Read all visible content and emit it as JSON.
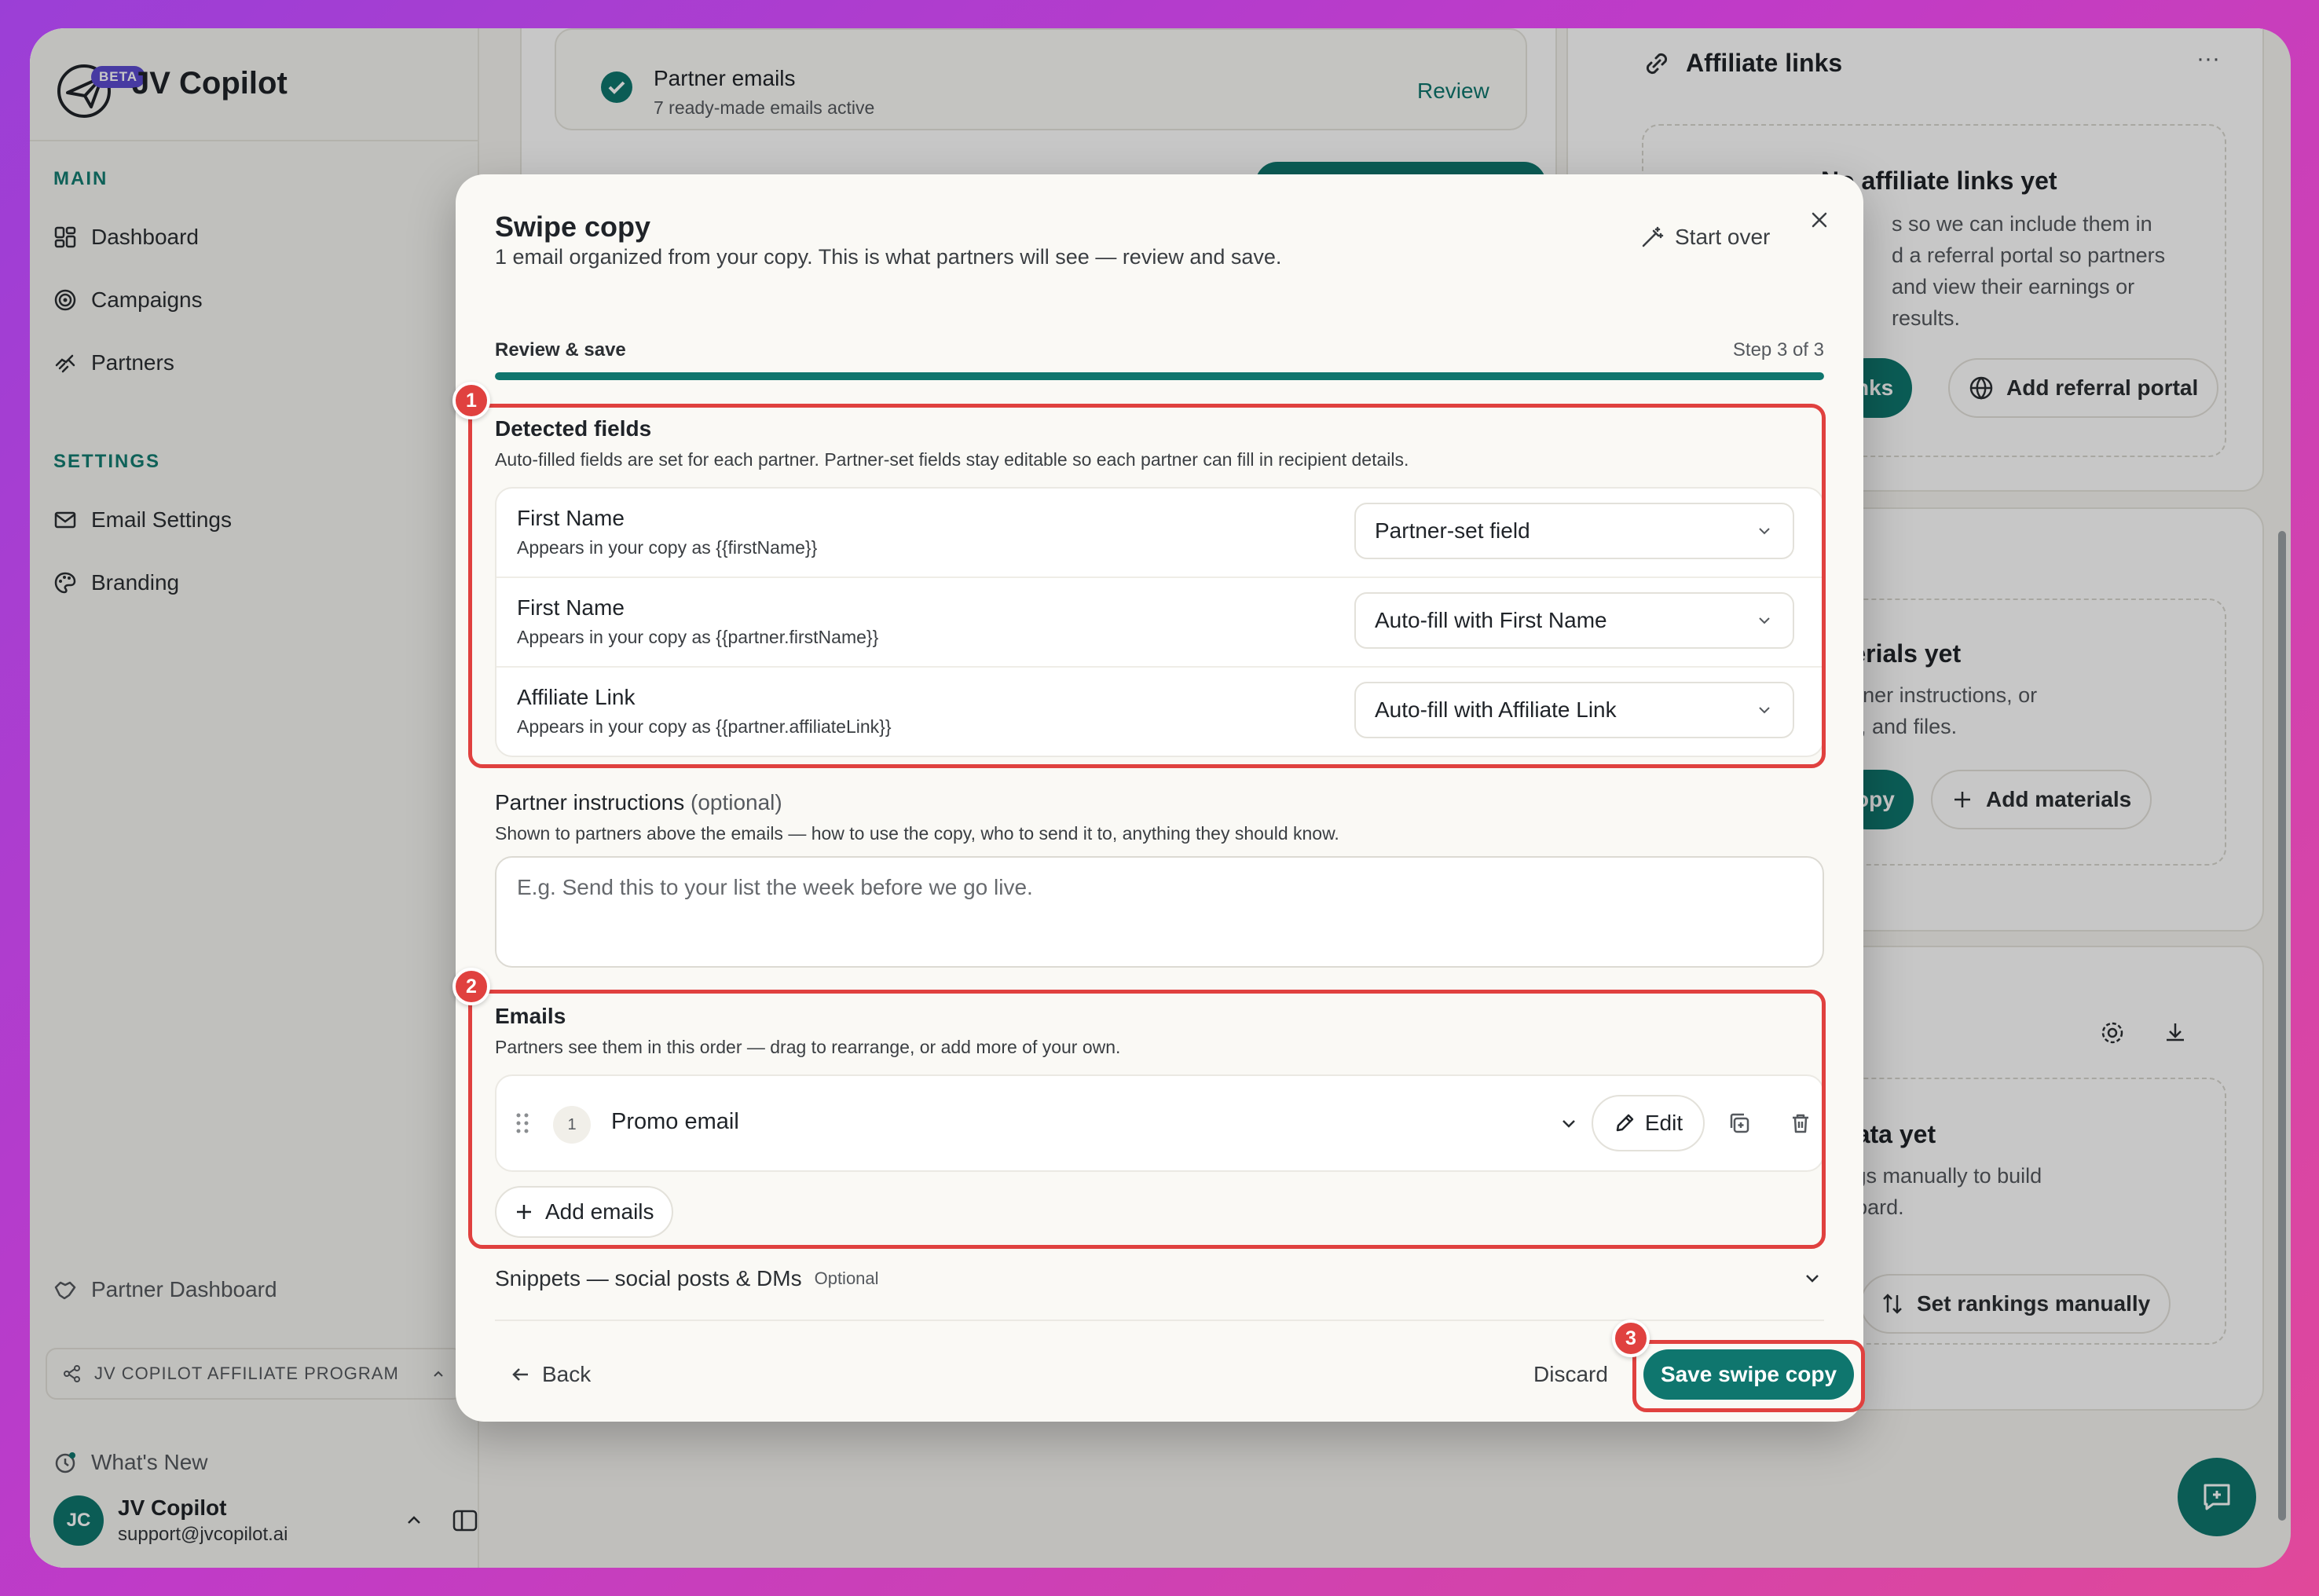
{
  "brand": {
    "name": "JV Copilot",
    "badge": "BETA"
  },
  "sidebar": {
    "main_label": "MAIN",
    "main_items": [
      {
        "label": "Dashboard",
        "icon": "dashboard-icon"
      },
      {
        "label": "Campaigns",
        "icon": "target-icon"
      },
      {
        "label": "Partners",
        "icon": "handshake-icon"
      }
    ],
    "settings_label": "SETTINGS",
    "settings_items": [
      {
        "label": "Email Settings",
        "icon": "mail-icon"
      },
      {
        "label": "Branding",
        "icon": "palette-icon"
      }
    ],
    "partner_dashboard": "Partner Dashboard",
    "program": "JV COPILOT AFFILIATE PROGRAM",
    "whats_new": "What's New",
    "user": {
      "initials": "JC",
      "name": "JV Copilot",
      "email": "support@jvcopilot.ai"
    }
  },
  "background": {
    "partner_emails": {
      "title": "Partner emails",
      "sub": "7 ready-made emails active",
      "action": "Review"
    },
    "affiliate": {
      "title": "Affiliate links",
      "empty_title": "No affiliate links yet",
      "empty_lines": [
        "s so we can include them in",
        "d a referral portal so partners",
        "and view their earnings or",
        "results."
      ],
      "btn_partial": "nks",
      "btn_portal": "Add referral portal"
    },
    "materials": {
      "empty_title": "o materials yet",
      "lines": [
        "and partner instructions, or",
        "cs, links, and files."
      ],
      "btn_partial": "opy",
      "btn_add": "Add materials"
    },
    "sales": {
      "empty_title": "ales data yet",
      "lines": [
        "t rankings manually to build",
        "leaderboard."
      ],
      "btn": "Set rankings manually"
    }
  },
  "modal": {
    "title": "Swipe copy",
    "subtitle": "1 email organized from your copy. This is what partners will see — review and save.",
    "start_over": "Start over",
    "step_label": "Review & save",
    "step_count": "Step 3 of 3",
    "progress": 1.0,
    "detected": {
      "title": "Detected fields",
      "desc": "Auto-filled fields are set for each partner. Partner-set fields stay editable so each partner can fill in recipient details.",
      "fields": [
        {
          "name": "First Name",
          "hint": "Appears in your copy as {{firstName}}",
          "value": "Partner-set field"
        },
        {
          "name": "First Name",
          "hint": "Appears in your copy as {{partner.firstName}}",
          "value": "Auto-fill with First Name"
        },
        {
          "name": "Affiliate Link",
          "hint": "Appears in your copy as {{partner.affiliateLink}}",
          "value": "Auto-fill with Affiliate Link"
        }
      ]
    },
    "instructions": {
      "title": "Partner instructions",
      "optional": "(optional)",
      "desc": "Shown to partners above the emails — how to use the copy, who to send it to, anything they should know.",
      "placeholder": "E.g. Send this to your list the week before we go live."
    },
    "emails": {
      "title": "Emails",
      "desc": "Partners see them in this order — drag to rearrange, or add more of your own.",
      "items": [
        {
          "index": "1",
          "title": "Promo email"
        }
      ],
      "edit_label": "Edit",
      "add_label": "Add emails"
    },
    "snippets": {
      "title": "Snippets — social posts & DMs",
      "optional": "Optional"
    },
    "back": "Back",
    "discard": "Discard",
    "save": "Save swipe copy"
  },
  "annotations": [
    "1",
    "2",
    "3"
  ],
  "colors": {
    "accent": "#0f766e",
    "highlight": "#e0413f"
  }
}
